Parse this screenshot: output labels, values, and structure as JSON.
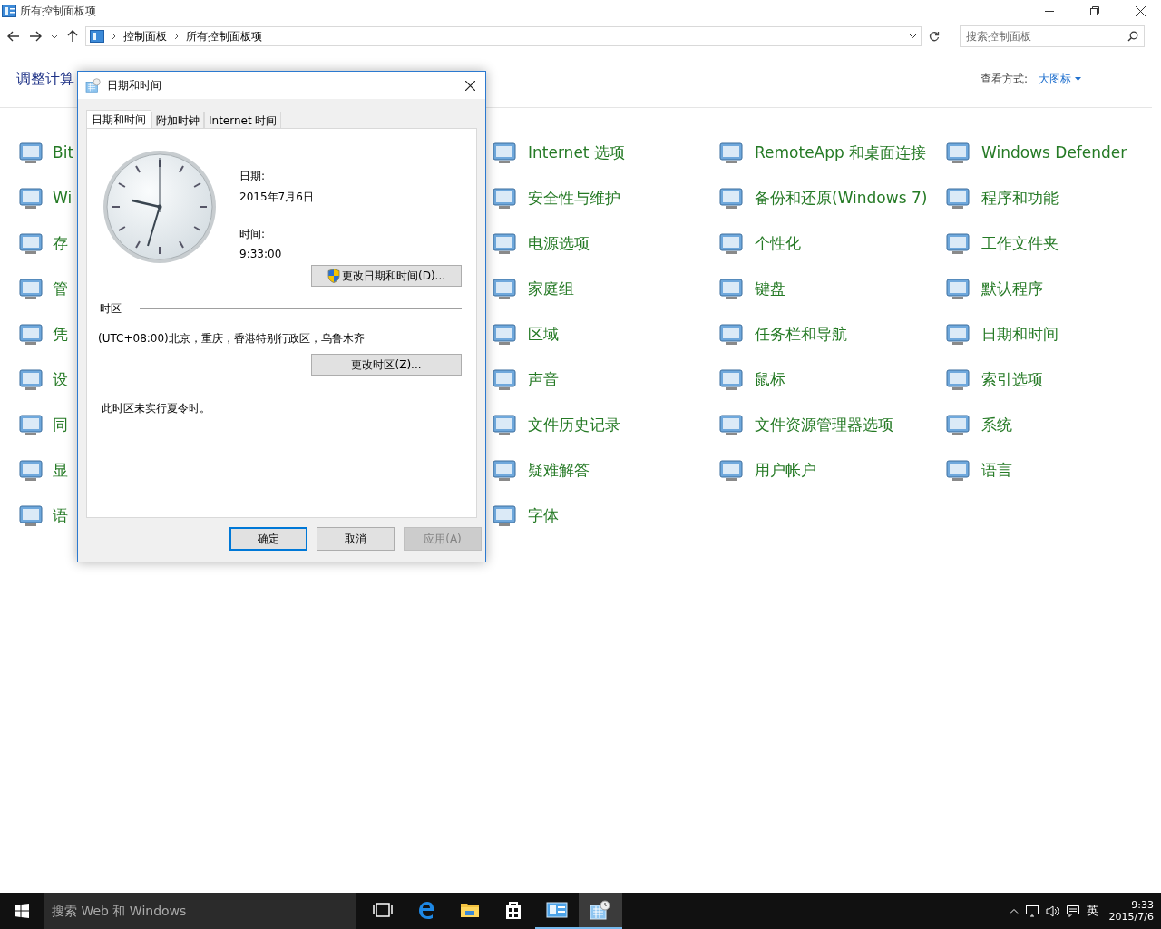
{
  "window": {
    "title": "所有控制面板项"
  },
  "address_bar": {
    "breadcrumbs": [
      "控制面板",
      "所有控制面板项"
    ]
  },
  "search": {
    "placeholder": "搜索控制面板"
  },
  "heading": "调整计算",
  "view_by": {
    "label": "查看方式:",
    "value": "大图标"
  },
  "columns": [
    {
      "items": [
        {
          "label": "Bit"
        },
        {
          "label": "Wi"
        },
        {
          "label": "存"
        },
        {
          "label": "管"
        },
        {
          "label": "凭"
        },
        {
          "label": "设"
        },
        {
          "label": "同"
        },
        {
          "label": "显"
        },
        {
          "label": "语"
        }
      ]
    },
    {
      "items": [
        {
          "label": "Internet 选项"
        },
        {
          "label": "安全性与维护"
        },
        {
          "label": "电源选项"
        },
        {
          "label": "家庭组"
        },
        {
          "label": "区域"
        },
        {
          "label": "声音"
        },
        {
          "label": "文件历史记录"
        },
        {
          "label": "疑难解答"
        },
        {
          "label": "字体"
        }
      ]
    },
    {
      "items": [
        {
          "label": "RemoteApp 和桌面连接"
        },
        {
          "label": "备份和还原(Windows 7)"
        },
        {
          "label": "个性化"
        },
        {
          "label": "键盘"
        },
        {
          "label": "任务栏和导航"
        },
        {
          "label": "鼠标"
        },
        {
          "label": "文件资源管理器选项"
        },
        {
          "label": "用户帐户"
        }
      ]
    },
    {
      "items": [
        {
          "label": "Windows Defender"
        },
        {
          "label": "程序和功能"
        },
        {
          "label": "工作文件夹"
        },
        {
          "label": "默认程序"
        },
        {
          "label": "日期和时间"
        },
        {
          "label": "索引选项"
        },
        {
          "label": "系统"
        },
        {
          "label": "语言"
        }
      ]
    }
  ],
  "dialog": {
    "title": "日期和时间",
    "tabs": [
      {
        "label": "日期和时间",
        "selected": true
      },
      {
        "label": "附加时钟",
        "selected": false
      },
      {
        "label": "Internet 时间",
        "selected": false
      }
    ],
    "date_label": "日期:",
    "date": "2015年7月6日",
    "time_label": "时间:",
    "time": "9:33:00",
    "change_datetime_button": "更改日期和时间(D)...",
    "timezone_heading": "时区",
    "timezone": "(UTC+08:00)北京，重庆，香港特别行政区，乌鲁木齐",
    "change_timezone_button": "更改时区(Z)...",
    "dst_note": "此时区未实行夏令时。",
    "buttons": [
      {
        "label": "确定",
        "default": true,
        "disabled": false
      },
      {
        "label": "取消",
        "default": false,
        "disabled": false
      },
      {
        "label": "应用(A)",
        "default": false,
        "disabled": true
      }
    ]
  },
  "taskbar": {
    "search_placeholder": "搜索 Web 和 Windows",
    "apps": [
      {
        "kind": "taskview",
        "running": false,
        "selected": false
      },
      {
        "kind": "edge",
        "running": false,
        "selected": false
      },
      {
        "kind": "explorer",
        "running": false,
        "selected": false
      },
      {
        "kind": "store",
        "running": false,
        "selected": false
      },
      {
        "kind": "controlpanel",
        "running": true,
        "selected": false
      },
      {
        "kind": "datetime",
        "running": true,
        "selected": true
      }
    ],
    "input_method": "英",
    "time": "9:33",
    "date": "2015/7/6"
  }
}
